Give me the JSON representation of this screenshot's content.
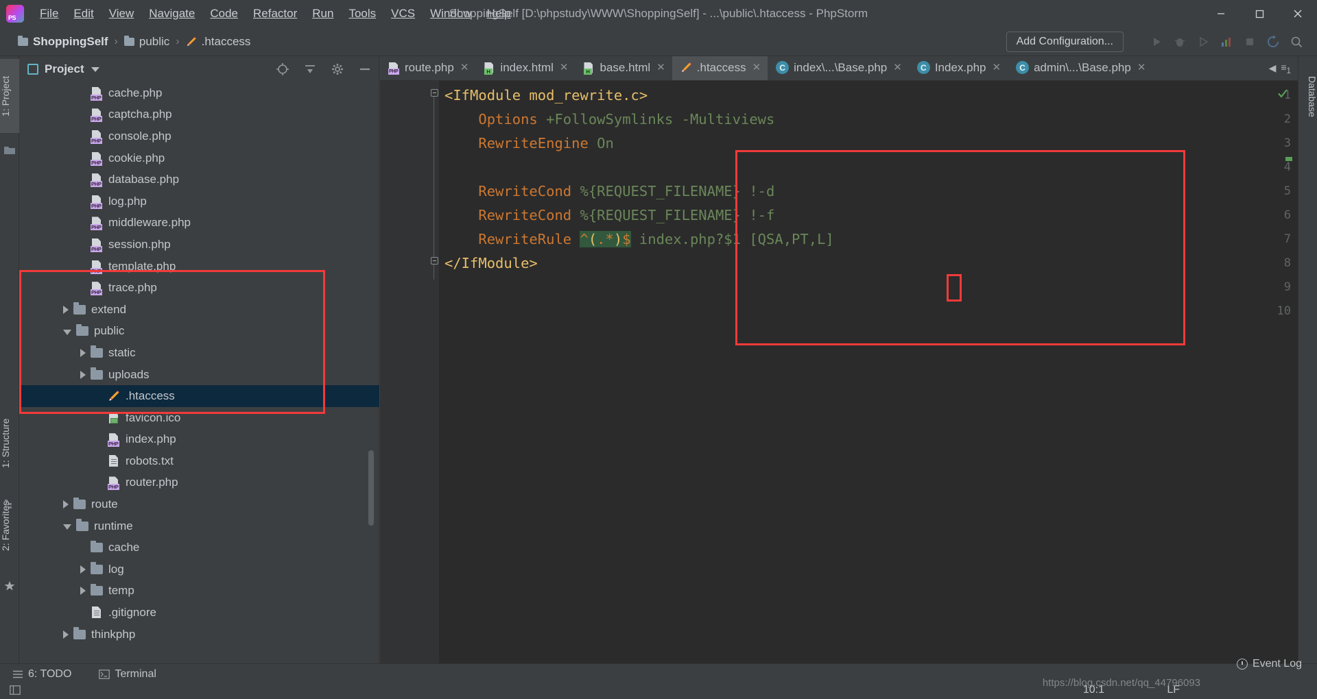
{
  "window": {
    "title": "ShoppingSelf [D:\\phpstudy\\WWW\\ShoppingSelf] - ...\\public\\.htaccess - PhpStorm",
    "minimize": "—",
    "maximize": "❐",
    "close": "✕"
  },
  "menu": [
    {
      "label": "File"
    },
    {
      "label": "Edit"
    },
    {
      "label": "View"
    },
    {
      "label": "Navigate"
    },
    {
      "label": "Code"
    },
    {
      "label": "Refactor"
    },
    {
      "label": "Run"
    },
    {
      "label": "Tools"
    },
    {
      "label": "VCS"
    },
    {
      "label": "Window"
    },
    {
      "label": "Help"
    }
  ],
  "breadcrumb": [
    {
      "label": "ShoppingSelf",
      "icon": "folder-icon"
    },
    {
      "label": "public",
      "icon": "folder-icon"
    },
    {
      "label": ".htaccess",
      "icon": "htaccess-icon"
    }
  ],
  "breadcrumb_separator": "›",
  "toolbar": {
    "add_configuration": "Add Configuration...",
    "icons": [
      "run-icon",
      "debug-icon",
      "run-with-coverage-icon",
      "profile-icon",
      "stop-icon",
      "update-icon",
      "search-everywhere-icon"
    ]
  },
  "left_strip": {
    "project_tab": "1: Project",
    "structure_tab": "1: Structure",
    "favorites_tab": "2: Favorites"
  },
  "right_strip": {
    "database_tab": "Database"
  },
  "project_panel": {
    "title": "Project",
    "header_icons": [
      "locate-icon",
      "collapse-all-icon",
      "settings-gear-icon",
      "hide-icon"
    ],
    "tree": [
      {
        "label": "cache.php",
        "indent": 3,
        "icon": "php-file-icon",
        "arrow": "none",
        "selected": false
      },
      {
        "label": "captcha.php",
        "indent": 3,
        "icon": "php-file-icon",
        "arrow": "none",
        "selected": false
      },
      {
        "label": "console.php",
        "indent": 3,
        "icon": "php-file-icon",
        "arrow": "none",
        "selected": false
      },
      {
        "label": "cookie.php",
        "indent": 3,
        "icon": "php-file-icon",
        "arrow": "none",
        "selected": false
      },
      {
        "label": "database.php",
        "indent": 3,
        "icon": "php-file-icon",
        "arrow": "none",
        "selected": false
      },
      {
        "label": "log.php",
        "indent": 3,
        "icon": "php-file-icon",
        "arrow": "none",
        "selected": false
      },
      {
        "label": "middleware.php",
        "indent": 3,
        "icon": "php-file-icon",
        "arrow": "none",
        "selected": false
      },
      {
        "label": "session.php",
        "indent": 3,
        "icon": "php-file-icon",
        "arrow": "none",
        "selected": false
      },
      {
        "label": "template.php",
        "indent": 3,
        "icon": "php-file-icon",
        "arrow": "none",
        "selected": false
      },
      {
        "label": "trace.php",
        "indent": 3,
        "icon": "php-file-icon",
        "arrow": "none",
        "selected": false
      },
      {
        "label": "extend",
        "indent": 2,
        "icon": "folder-icon",
        "arrow": "closed",
        "selected": false
      },
      {
        "label": "public",
        "indent": 2,
        "icon": "folder-icon",
        "arrow": "open",
        "selected": false
      },
      {
        "label": "static",
        "indent": 3,
        "icon": "folder-icon",
        "arrow": "closed",
        "selected": false
      },
      {
        "label": "uploads",
        "indent": 3,
        "icon": "folder-icon",
        "arrow": "closed",
        "selected": false
      },
      {
        "label": ".htaccess",
        "indent": 4,
        "icon": "htaccess-icon",
        "arrow": "none",
        "selected": true
      },
      {
        "label": "favicon.ico",
        "indent": 4,
        "icon": "image-file-icon",
        "arrow": "none",
        "selected": false
      },
      {
        "label": "index.php",
        "indent": 4,
        "icon": "php-file-icon",
        "arrow": "none",
        "selected": false
      },
      {
        "label": "robots.txt",
        "indent": 4,
        "icon": "text-file-icon",
        "arrow": "none",
        "selected": false
      },
      {
        "label": "router.php",
        "indent": 4,
        "icon": "php-file-icon",
        "arrow": "none",
        "selected": false
      },
      {
        "label": "route",
        "indent": 2,
        "icon": "folder-icon",
        "arrow": "closed",
        "selected": false
      },
      {
        "label": "runtime",
        "indent": 2,
        "icon": "folder-icon",
        "arrow": "open",
        "selected": false
      },
      {
        "label": "cache",
        "indent": 3,
        "icon": "folder-icon",
        "arrow": "none",
        "selected": false
      },
      {
        "label": "log",
        "indent": 3,
        "icon": "folder-icon",
        "arrow": "closed",
        "selected": false
      },
      {
        "label": "temp",
        "indent": 3,
        "icon": "folder-icon",
        "arrow": "closed",
        "selected": false
      },
      {
        "label": ".gitignore",
        "indent": 3,
        "icon": "git-file-icon",
        "arrow": "none",
        "selected": false
      },
      {
        "label": "thinkphp",
        "indent": 2,
        "icon": "folder-icon",
        "arrow": "closed",
        "selected": false
      }
    ]
  },
  "editor_tabs": [
    {
      "label": "route.php",
      "icon": "php-file-icon",
      "active": false,
      "close": "✕"
    },
    {
      "label": "index.html",
      "icon": "html-file-icon",
      "active": false,
      "close": "✕"
    },
    {
      "label": "base.html",
      "icon": "html-file-icon",
      "active": false,
      "close": "✕"
    },
    {
      "label": ".htaccess",
      "icon": "htaccess-icon",
      "active": true,
      "close": "✕"
    },
    {
      "label": "index\\...\\Base.php",
      "icon": "php-class-icon",
      "active": false,
      "close": "✕"
    },
    {
      "label": "Index.php",
      "icon": "php-class-icon",
      "active": false,
      "close": "✕"
    },
    {
      "label": "admin\\...\\Base.php",
      "icon": "php-class-icon",
      "active": false,
      "close": "✕"
    }
  ],
  "editor_tabs_overflow": "◀",
  "editor": {
    "lines": [
      {
        "n": 1,
        "tokens": [
          {
            "t": "<IfModule mod_rewrite.c>",
            "c": "k-tag"
          }
        ],
        "fold": "open"
      },
      {
        "n": 2,
        "tokens": [
          {
            "t": "    ",
            "c": "k-gray"
          },
          {
            "t": "Options",
            "c": "k-dir"
          },
          {
            "t": " +FollowSymlinks -Multiviews",
            "c": "k-val"
          }
        ]
      },
      {
        "n": 3,
        "tokens": [
          {
            "t": "    ",
            "c": "k-gray"
          },
          {
            "t": "RewriteEngine",
            "c": "k-dir"
          },
          {
            "t": " On",
            "c": "k-val"
          }
        ]
      },
      {
        "n": 4,
        "tokens": []
      },
      {
        "n": 5,
        "tokens": [
          {
            "t": "    ",
            "c": "k-gray"
          },
          {
            "t": "RewriteCond",
            "c": "k-dir"
          },
          {
            "t": " %{REQUEST_FILENAME} !-d",
            "c": "k-val"
          }
        ]
      },
      {
        "n": 6,
        "tokens": [
          {
            "t": "    ",
            "c": "k-gray"
          },
          {
            "t": "RewriteCond",
            "c": "k-dir"
          },
          {
            "t": " %{REQUEST_FILENAME} !-f",
            "c": "k-val"
          }
        ]
      },
      {
        "n": 7,
        "tokens": [
          {
            "t": "    ",
            "c": "k-gray"
          },
          {
            "t": "RewriteRule",
            "c": "k-dir"
          },
          {
            "t": " ",
            "c": "k-val"
          },
          {
            "t": "^(.*)$",
            "c": "k-hl-regex"
          },
          {
            "t": " index.php?$1 [QSA,PT,L]",
            "c": "k-val"
          }
        ]
      },
      {
        "n": 8,
        "tokens": [
          {
            "t": "</IfModule>",
            "c": "k-tag"
          }
        ],
        "fold": "close"
      },
      {
        "n": 9,
        "tokens": []
      },
      {
        "n": 10,
        "tokens": []
      }
    ],
    "full_text": "<IfModule mod_rewrite.c>\n    Options +FollowSymlinks -Multiviews\n    RewriteEngine On\n\n    RewriteCond %{REQUEST_FILENAME} !-d\n    RewriteCond %{REQUEST_FILENAME} !-f\n    RewriteRule ^(.*)$ index.php?$1 [QSA,PT,L]\n</IfModule>",
    "highlighted_token": "^(.*)$",
    "annotation_boxes": [
      {
        "name": "code-block-highlight",
        "color": "#f33a3a"
      },
      {
        "name": "question-mark-highlight",
        "color": "#f33a3a"
      },
      {
        "name": "public-folder-highlight",
        "color": "#f33a3a"
      }
    ]
  },
  "bottom_bar": {
    "todo": "6: TODO",
    "todo_prefix": "☰",
    "terminal": "Terminal",
    "event_log": "Event Log"
  },
  "status_bar": {
    "caret_position": "10:1",
    "line_separator": "LF",
    "watermark": "https://blog.csdn.net/qq_44796093"
  },
  "colors": {
    "accent_red": "#f33a3a",
    "selection_blue": "#0d293e",
    "editor_bg": "#2b2b2b",
    "panel_bg": "#3c3f41",
    "gutter_bg": "#313335",
    "directive": "#cc7832",
    "value": "#6a8759",
    "tag": "#e8bf6a",
    "highlight_bg": "#32593d"
  }
}
